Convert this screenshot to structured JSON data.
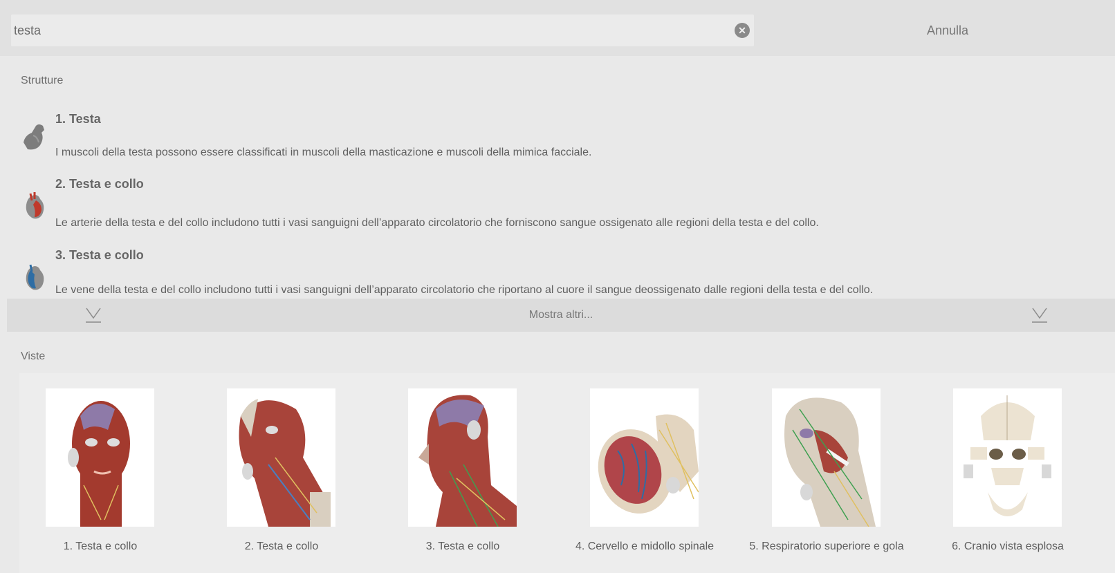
{
  "search": {
    "value": "testa",
    "clear_icon": "clear-icon",
    "cancel_label": "Annulla"
  },
  "structures": {
    "heading": "Strutture",
    "items": [
      {
        "title": "1. Testa",
        "description": "I muscoli della testa possono essere classificati in muscoli della masticazione e muscoli della mimica facciale.",
        "icon": "muscle-arm-icon"
      },
      {
        "title": "2. Testa e collo",
        "description": "Le arterie della testa e del collo includono tutti i vasi sanguigni dell’apparato circolatorio che forniscono sangue ossigenato alle regioni della testa e del collo.",
        "icon": "heart-artery-icon"
      },
      {
        "title": "3. Testa e collo",
        "description": "Le vene della testa e del collo includono tutti i vasi sanguigni dell’apparato circolatorio che riportano al cuore il sangue deossigenato dalle regioni della testa e del collo.",
        "icon": "heart-vein-icon"
      }
    ],
    "show_more_label": "Mostra altri..."
  },
  "views": {
    "heading": "Viste",
    "items": [
      {
        "label": "1. Testa e collo"
      },
      {
        "label": "2. Testa e collo"
      },
      {
        "label": "3. Testa e collo"
      },
      {
        "label": "4. Cervello e midollo spinale"
      },
      {
        "label": "5. Respiratorio superiore e gola"
      },
      {
        "label": "6. Cranio vista esplosa"
      }
    ]
  },
  "colors": {
    "muscle": "#a33a2e",
    "artery": "#c0392b",
    "vein": "#2e6da4",
    "bone": "#e8dcc4"
  }
}
